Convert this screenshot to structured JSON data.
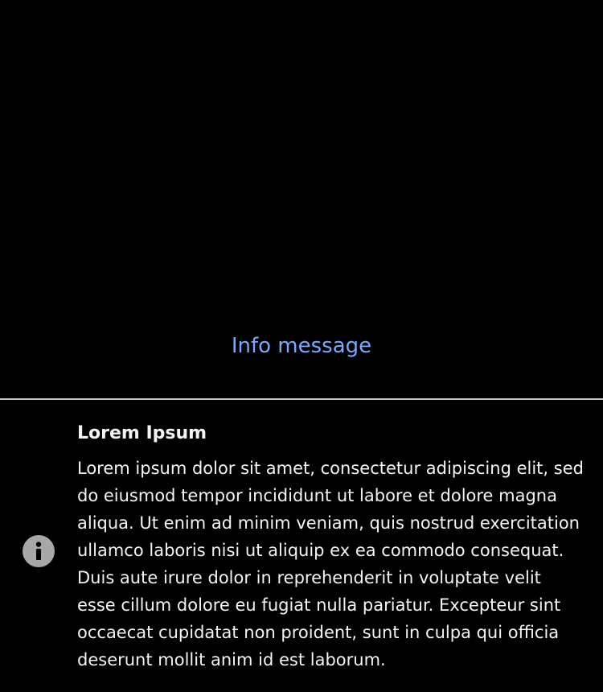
{
  "trigger": {
    "link_label": "Info message",
    "link_color": "#78a9ff"
  },
  "toast": {
    "kind": "info",
    "icon": "info-icon",
    "title": "Lorem Ipsum",
    "body": "Lorem ipsum dolor sit amet, consectetur adipiscing elit, sed do eiusmod tempor incididunt ut labore et dolore magna aliqua. Ut enim ad minim veniam, quis nostrud exercitation ullamco laboris nisi ut aliquip ex ea commodo consequat. Duis aute irure dolor in reprehenderit in voluptate velit esse cillum dolore eu fugiat nulla pariatur. Excepteur sint occaecat cupidatat non proident, sunt in culpa qui officia deserunt mollit anim id est laborum.",
    "icon_color": "#a8a8a8",
    "background": "#000000",
    "divider_color": "#c6c6c6"
  }
}
